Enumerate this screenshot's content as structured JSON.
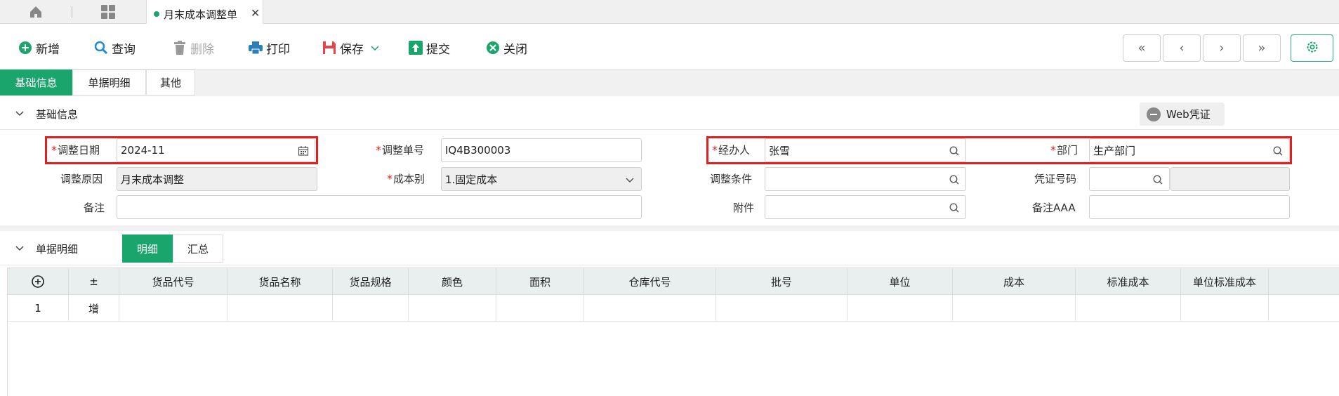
{
  "tabs": {
    "doc_tab_label": "月末成本调整单"
  },
  "toolbar": {
    "new": "新增",
    "query": "查询",
    "delete": "删除",
    "print": "打印",
    "save": "保存",
    "submit": "提交",
    "close": "关闭"
  },
  "page_tabs": [
    "基础信息",
    "单据明细",
    "其他"
  ],
  "basic_section": {
    "title": "基础信息",
    "web_voucher": "Web凭证"
  },
  "form": {
    "adjust_date": {
      "label": "调整日期",
      "value": "2024-11"
    },
    "adjust_no": {
      "label": "调整单号",
      "value": "IQ4B300003"
    },
    "handler": {
      "label": "经办人",
      "value": "张雪"
    },
    "dept": {
      "label": "部门",
      "value": "生产部门"
    },
    "adjust_reason": {
      "label": "调整原因",
      "value": "月末成本调整"
    },
    "cost_type": {
      "label": "成本别",
      "value": "1.固定成本"
    },
    "adjust_cond": {
      "label": "调整条件",
      "value": ""
    },
    "voucher_no": {
      "label": "凭证号码",
      "value": ""
    },
    "remark": {
      "label": "备注",
      "value": ""
    },
    "attachment": {
      "label": "附件",
      "value": ""
    },
    "remark_aaa": {
      "label": "备注AAA",
      "value": ""
    }
  },
  "detail_section": {
    "title": "单据明细",
    "tab_detail": "明细",
    "tab_summary": "汇总"
  },
  "grid": {
    "columns": [
      "±",
      "货品代号",
      "货品名称",
      "货品规格",
      "颜色",
      "面积",
      "仓库代号",
      "批号",
      "单位",
      "成本",
      "标准成本",
      "单位标准成本"
    ],
    "rows": [
      {
        "index": "1",
        "op": "增"
      }
    ]
  },
  "colors": {
    "accent": "#19a56b",
    "required": "#e02020"
  }
}
